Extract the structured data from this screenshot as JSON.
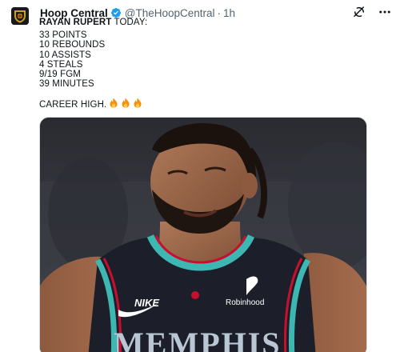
{
  "tweet": {
    "author": {
      "display_name": "Hoop Central",
      "handle": "@TheHoopCentral",
      "separator": "·",
      "time": "1h",
      "verified": true,
      "avatar_icon": "hoop-central-shield-logo"
    },
    "actions": {
      "grok_icon": "grok-icon",
      "more_icon": "more-icon"
    },
    "text": {
      "name": "RAYAN RUPERT",
      "headline_rest": " TODAY:",
      "stats": [
        "33 POINTS",
        "10 REBOUNDS",
        "10 ASSISTS",
        "4 STEALS",
        "9/19 FGM",
        "39 MINUTES"
      ],
      "closing": "CAREER HIGH.",
      "emoji": [
        "fire-emoji",
        "fire-emoji",
        "fire-emoji"
      ]
    },
    "media": {
      "jersey_wordmark": "MEMPHIS",
      "jersey_brand": "NIKE",
      "jersey_sponsor": "Robinhood"
    }
  },
  "colors": {
    "verified_blue": "#1d9bf0",
    "secondary_text": "#536471",
    "jersey_navy": "#1c1f2a",
    "jersey_teal": "#3eb7b3",
    "jersey_red": "#c8102e"
  }
}
